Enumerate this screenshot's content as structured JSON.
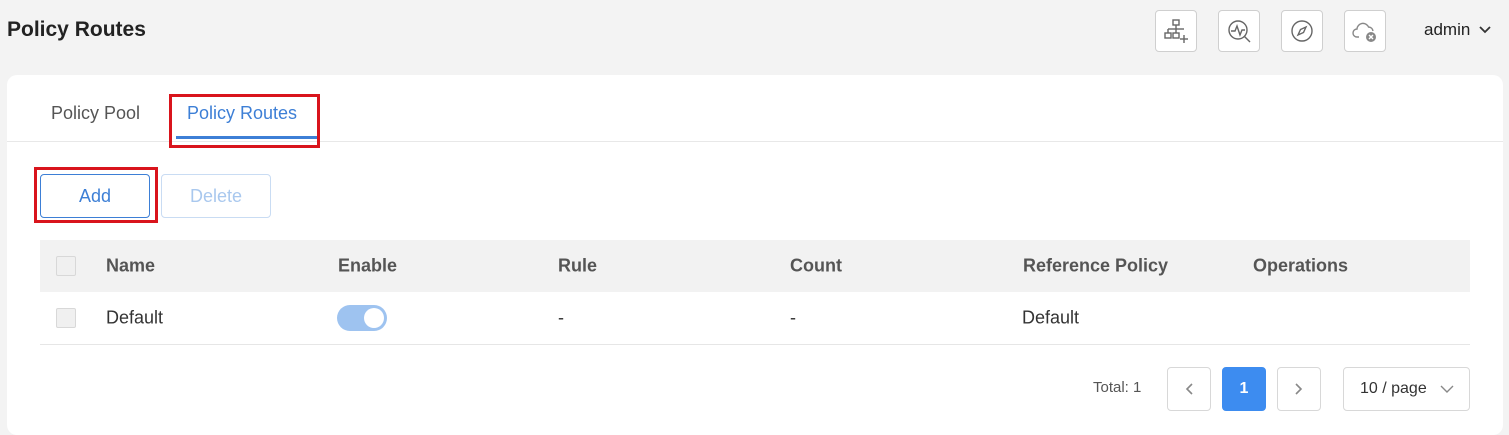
{
  "header": {
    "title": "Policy Routes",
    "icons": [
      "network-add-icon",
      "diagnostics-icon",
      "compass-icon",
      "cloud-disconnected-icon"
    ],
    "user": "admin"
  },
  "tabs": [
    {
      "label": "Policy Pool",
      "active": false
    },
    {
      "label": "Policy Routes",
      "active": true
    }
  ],
  "toolbar": {
    "add_label": "Add",
    "delete_label": "Delete"
  },
  "table": {
    "columns": [
      "Name",
      "Enable",
      "Rule",
      "Count",
      "Reference Policy",
      "Operations"
    ],
    "rows": [
      {
        "name": "Default",
        "enabled": true,
        "rule": "-",
        "count": "-",
        "reference_policy": "Default",
        "operations": ""
      }
    ]
  },
  "pagination": {
    "total": "Total: 1",
    "current_page": "1",
    "page_size": "10 / page"
  },
  "colors": {
    "accent": "#3d7fd6",
    "highlight": "#d9141c",
    "toggle_on": "#9ec3f0"
  }
}
